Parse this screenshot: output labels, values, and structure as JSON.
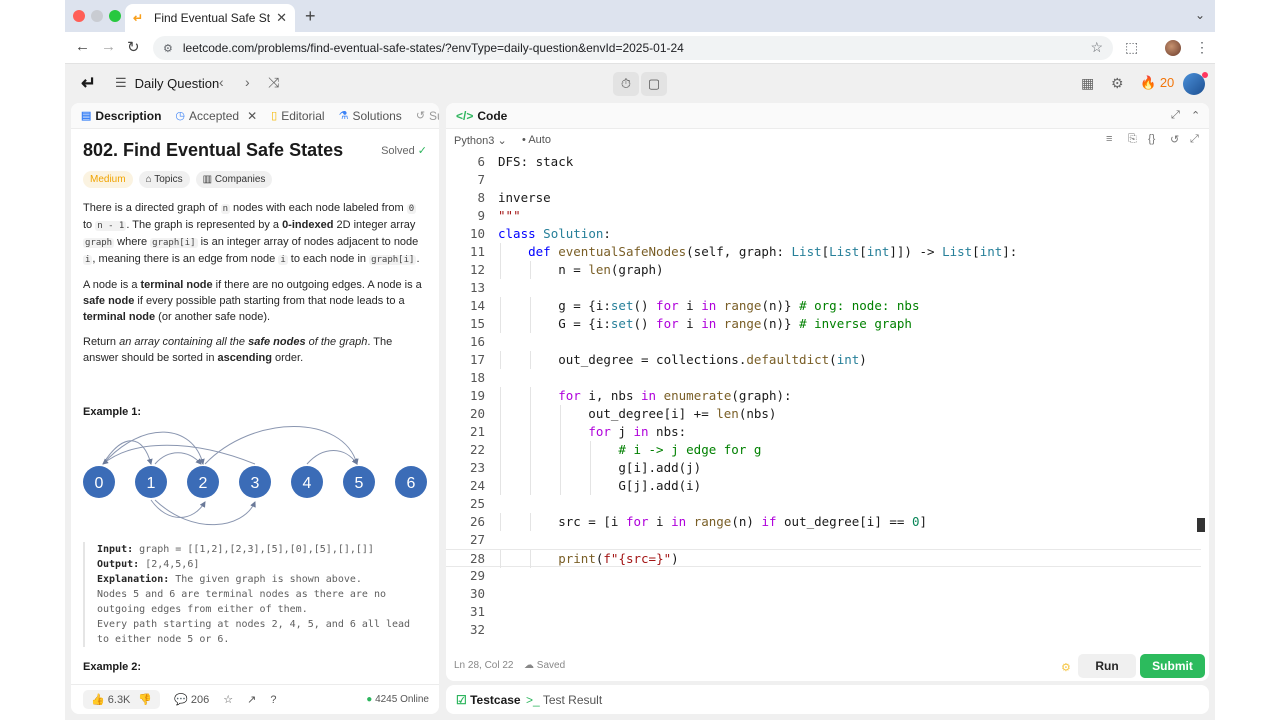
{
  "browser": {
    "tab_title": "Find Eventual Safe States - Le",
    "url": "leetcode.com/problems/find-eventual-safe-states/?envType=daily-question&envId=2025-01-24"
  },
  "header": {
    "daily_label": "Daily Question",
    "streak": "20"
  },
  "left_tabs": [
    {
      "label": "Description"
    },
    {
      "label": "Accepted"
    },
    {
      "label": "Editorial"
    },
    {
      "label": "Solutions"
    },
    {
      "label": "Sub"
    }
  ],
  "problem": {
    "title": "802. Find Eventual Safe States",
    "status": "Solved",
    "difficulty": "Medium",
    "topics_label": "Topics",
    "companies_label": "Companies",
    "p1": [
      "There is a directed graph of ",
      "n",
      " nodes with each node labeled from ",
      "0",
      " to ",
      "n - 1",
      ". The graph is represented by a ",
      "0-indexed",
      " 2D integer array ",
      "graph",
      " where ",
      "graph[i]",
      " is an integer array of nodes adjacent to node ",
      "i",
      ", meaning there is an edge from node ",
      "i",
      " to each node in ",
      "graph[i]",
      "."
    ],
    "p2": [
      "A node is a ",
      "terminal node",
      " if there are no outgoing edges. A node is a ",
      "safe node",
      " if every possible path starting from that node leads to a ",
      "terminal node",
      " (or another safe node)."
    ],
    "p3": [
      "Return ",
      "an array containing all the ",
      "safe nodes",
      " of the graph",
      ". The answer should be sorted in ",
      "ascending",
      " order."
    ],
    "example1_title": "Example 1:",
    "graph_nodes": [
      "0",
      "1",
      "2",
      "3",
      "4",
      "5",
      "6"
    ],
    "input_label": "Input:",
    "input_value": "graph = [[1,2],[2,3],[5],[0],[5],[],[]]",
    "output_label": "Output:",
    "output_value": "[2,4,5,6]",
    "explanation_label": "Explanation:",
    "explanation_lines": [
      " The given graph is shown above.",
      "Nodes 5 and 6 are terminal nodes as there are no",
      "outgoing edges from either of them.",
      "Every path starting at nodes 2, 4, 5, and 6 all lead",
      "to either node 5 or 6."
    ],
    "example2_title": "Example 2:"
  },
  "left_footer": {
    "likes": "6.3K",
    "comments": "206",
    "online": "4245 Online"
  },
  "code_panel": {
    "title": "Code",
    "language": "Python3",
    "mode": "Auto",
    "cursor_position": "Ln 28, Col 22",
    "save_status": "Saved",
    "run_label": "Run",
    "submit_label": "Submit",
    "lines": [
      {
        "n": "6",
        "t": "DFS: stack"
      },
      {
        "n": "7",
        "t": ""
      },
      {
        "n": "8",
        "t": "inverse"
      },
      {
        "n": "9",
        "t": "\"\"\""
      },
      {
        "n": "10",
        "t": "class Solution:"
      },
      {
        "n": "11",
        "t": "    def eventualSafeNodes(self, graph: List[List[int]]) -> List[int]:"
      },
      {
        "n": "12",
        "t": "        n = len(graph)"
      },
      {
        "n": "13",
        "t": ""
      },
      {
        "n": "14",
        "t": "        g = {i:set() for i in range(n)} # org: node: nbs"
      },
      {
        "n": "15",
        "t": "        G = {i:set() for i in range(n)} # inverse graph"
      },
      {
        "n": "16",
        "t": ""
      },
      {
        "n": "17",
        "t": "        out_degree = collections.defaultdict(int)"
      },
      {
        "n": "18",
        "t": ""
      },
      {
        "n": "19",
        "t": "        for i, nbs in enumerate(graph):"
      },
      {
        "n": "20",
        "t": "            out_degree[i] += len(nbs)"
      },
      {
        "n": "21",
        "t": "            for j in nbs:"
      },
      {
        "n": "22",
        "t": "                # i -> j edge for g"
      },
      {
        "n": "23",
        "t": "                g[i].add(j)"
      },
      {
        "n": "24",
        "t": "                G[j].add(i)"
      },
      {
        "n": "25",
        "t": ""
      },
      {
        "n": "26",
        "t": "        src = [i for i in range(n) if out_degree[i] == 0]"
      },
      {
        "n": "27",
        "t": ""
      },
      {
        "n": "28",
        "t": "        print(f\"{src=}\")"
      },
      {
        "n": "29",
        "t": ""
      },
      {
        "n": "30",
        "t": ""
      },
      {
        "n": "31",
        "t": ""
      },
      {
        "n": "32",
        "t": ""
      }
    ]
  },
  "bottom_tabs": [
    {
      "label": "Testcase"
    },
    {
      "label": "Test Result"
    }
  ],
  "colors": {
    "accent_green": "#2cbb5d",
    "medium": "#f0a300",
    "node_fill": "#3b6cb7"
  }
}
